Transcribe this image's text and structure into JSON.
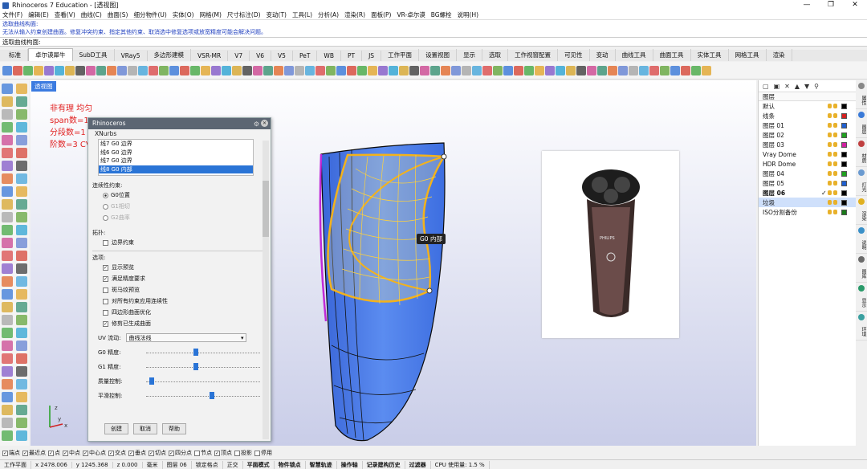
{
  "window": {
    "title": "Rhinoceros 7 Education - [透视图]",
    "min": "—",
    "max": "❐",
    "close": "✕"
  },
  "menu": [
    "文件(F)",
    "编辑(E)",
    "查看(V)",
    "曲线(C)",
    "曲面(S)",
    "细分物件(U)",
    "实体(O)",
    "网格(M)",
    "尺寸标注(D)",
    "变动(T)",
    "工具(L)",
    "分析(A)",
    "渲染(R)",
    "面板(P)",
    "VR-卓尔谟",
    "BG螺栓",
    "说明(H)"
  ],
  "command": {
    "history": [
      "选取曲线构面:",
      "无法从输入约束创建曲面。修复冲突约束、指定其他约束、取消选中修复选项或放宽精度可能会解决问题。"
    ],
    "prompt": "选取曲线构面:"
  },
  "tabs": [
    {
      "label": "标准",
      "active": false
    },
    {
      "label": "卓尔谟犀牛",
      "active": true
    },
    {
      "label": "SubD工具",
      "active": false
    },
    {
      "label": "VRay5",
      "active": false
    },
    {
      "label": "多边形建模",
      "active": false
    },
    {
      "label": "VSR-MR",
      "active": false
    },
    {
      "label": "V7",
      "active": false
    },
    {
      "label": "V6",
      "active": false
    },
    {
      "label": "V5",
      "active": false
    },
    {
      "label": "PeT",
      "active": false
    },
    {
      "label": "WB",
      "active": false
    },
    {
      "label": "PT",
      "active": false
    },
    {
      "label": "JS",
      "active": false
    },
    {
      "label": "工作平面",
      "active": false
    },
    {
      "label": "设置视图",
      "active": false
    },
    {
      "label": "显示",
      "active": false
    },
    {
      "label": "选取",
      "active": false
    },
    {
      "label": "工作视窗配置",
      "active": false
    },
    {
      "label": "可见性",
      "active": false
    },
    {
      "label": "变动",
      "active": false
    },
    {
      "label": "曲线工具",
      "active": false
    },
    {
      "label": "曲面工具",
      "active": false
    },
    {
      "label": "实体工具",
      "active": false
    },
    {
      "label": "网格工具",
      "active": false
    },
    {
      "label": "渲染",
      "active": false
    }
  ],
  "toolbar_colors": [
    "#2b6fd6",
    "#d43b2b",
    "#3aa33a",
    "#e0a020",
    "#7a4fc4",
    "#1f9ed0",
    "#d4a020",
    "#333333",
    "#c83a8a",
    "#2b8a6a",
    "#e06020",
    "#5a7ad0",
    "#a0a0a0",
    "#39a0d8",
    "#d84040",
    "#5aa030"
  ],
  "viewport": {
    "label": "透视图",
    "annotation": [
      "非有理 均匀",
      "span数=1",
      "分段数=1",
      "阶数=3  CV"
    ],
    "tooltip": "G0 内部",
    "product_image_label": "PHILIPS"
  },
  "dialog": {
    "title": "Rhinoceros",
    "subtitle": "XNurbs",
    "close": "✕",
    "gear": "⚙",
    "curves": [
      {
        "text": "线7   G0   边界",
        "selected": false
      },
      {
        "text": "线6   G0   边界",
        "selected": false
      },
      {
        "text": "线7   G0   边界",
        "selected": false
      },
      {
        "text": "线8   G0   内部",
        "selected": true
      }
    ],
    "continuity_label": "连续性约束:",
    "continuity": [
      {
        "label": "G0位置",
        "on": true,
        "disabled": false
      },
      {
        "label": "G1相切",
        "on": false,
        "disabled": true
      },
      {
        "label": "G2曲率",
        "on": false,
        "disabled": true
      }
    ],
    "extension_label": "拓扑:",
    "boundary_constraint": "边界约束",
    "options_label": "选项:",
    "options": [
      {
        "label": "显示预览",
        "checked": true
      },
      {
        "label": "满足精度要求",
        "checked": true
      },
      {
        "label": "斑马纹预览",
        "checked": false
      },
      {
        "label": "对所有约束应用连续性",
        "checked": false
      },
      {
        "label": "四边形曲面优化",
        "checked": false
      },
      {
        "label": "修剪已生成曲面",
        "checked": true
      }
    ],
    "uv_label": "UV 流动:",
    "uv_value": "曲线法线",
    "sliders": [
      {
        "label": "G0 精度:",
        "value": 0.44
      },
      {
        "label": "G1 精度:",
        "value": 0.44
      },
      {
        "label": "质量控制:",
        "value": 0.05
      },
      {
        "label": "平滑控制:",
        "value": 0.58
      }
    ],
    "buttons": [
      "创建",
      "取消",
      "帮助"
    ]
  },
  "layers": {
    "header": "图层",
    "items": [
      {
        "name": "默认",
        "color": "#000000",
        "selected": false,
        "current": false
      },
      {
        "name": "线条",
        "color": "#d42020",
        "selected": false,
        "current": false
      },
      {
        "name": "图层 01",
        "color": "#2060d0",
        "selected": false,
        "current": false
      },
      {
        "name": "图层 02",
        "color": "#20a020",
        "selected": false,
        "current": false
      },
      {
        "name": "图层 03",
        "color": "#d020a0",
        "selected": false,
        "current": false
      },
      {
        "name": "Vray Dome",
        "color": "#000000",
        "selected": false,
        "current": false
      },
      {
        "name": "HDR Dome",
        "color": "#000000",
        "selected": false,
        "current": false
      },
      {
        "name": "图层 04",
        "color": "#20a020",
        "selected": false,
        "current": false
      },
      {
        "name": "图层 05",
        "color": "#2060d0",
        "selected": false,
        "current": false
      },
      {
        "name": "图层 06",
        "color": "#000000",
        "selected": false,
        "current": true
      },
      {
        "name": "垃圾",
        "color": "#000000",
        "selected": true,
        "current": false
      },
      {
        "name": "ISO分割备份",
        "color": "#1a7a1a",
        "selected": false,
        "current": false
      }
    ]
  },
  "right_tabs": [
    "属性",
    "图层",
    "材质",
    "灯光",
    "渲染",
    "说明",
    "图库",
    "显示",
    "环境"
  ],
  "osnap": [
    {
      "label": "端点",
      "checked": true
    },
    {
      "label": "最近点",
      "checked": true
    },
    {
      "label": "点",
      "checked": true
    },
    {
      "label": "中点",
      "checked": true
    },
    {
      "label": "中心点",
      "checked": true
    },
    {
      "label": "交点",
      "checked": true
    },
    {
      "label": "垂点",
      "checked": true
    },
    {
      "label": "切点",
      "checked": true
    },
    {
      "label": "四分点",
      "checked": true
    },
    {
      "label": "节点",
      "checked": false
    },
    {
      "label": "顶点",
      "checked": true
    },
    {
      "label": "投影",
      "checked": false
    },
    {
      "label": "停用",
      "checked": false
    }
  ],
  "status": {
    "cplane": "工作平面",
    "x": "x 2478.006",
    "y": "y 1245.368",
    "z": "z 0.000",
    "unit": "毫米",
    "layer": "图层 06",
    "items": [
      "锁定格点",
      "正交",
      "平面模式",
      "物件锁点",
      "智慧轨迹",
      "操作轴",
      "记录建构历史",
      "过滤器"
    ],
    "cpu": "CPU 使用量: 1.5 %"
  }
}
